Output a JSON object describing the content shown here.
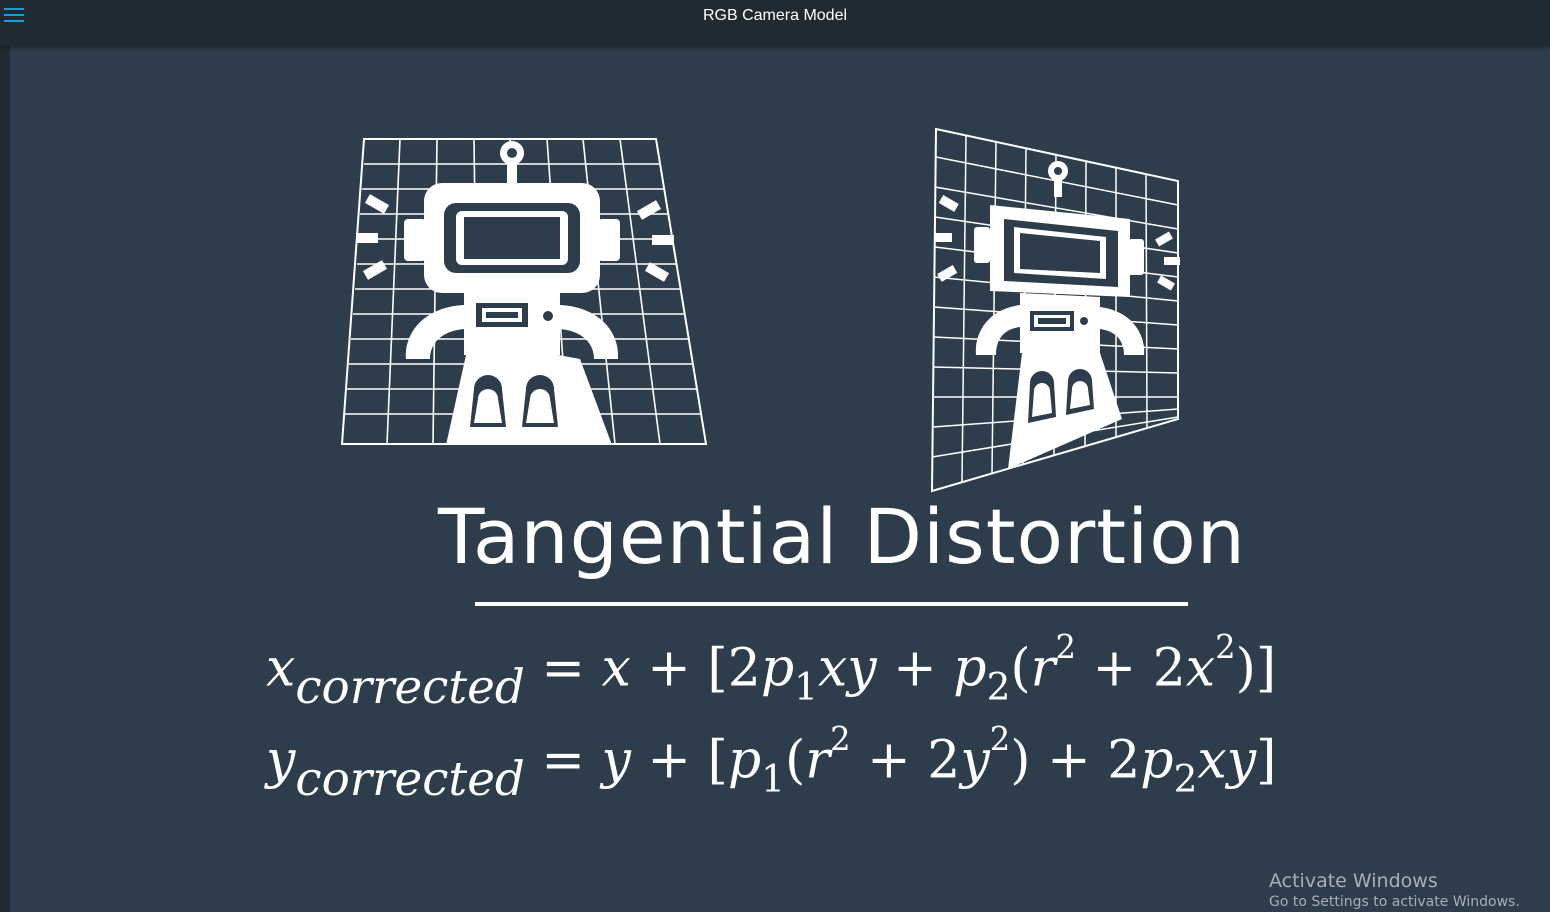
{
  "app": {
    "title": "RGB Camera Model",
    "menu_icon": "hamburger-menu-icon"
  },
  "slide": {
    "title": "Tangential Distortion",
    "equation_1": {
      "lhs_var": "x",
      "lhs_sub": "corrected",
      "eq": " = ",
      "var_x": "x",
      "plus": " + ",
      "open_bracket": "[",
      "coef_2": "2",
      "p": "p",
      "sub_1": "1",
      "xy": "xy",
      "plus_2": " + ",
      "p_2": "p",
      "sub_2": "2",
      "open_paren": "(",
      "r": "r",
      "sup_2": "2",
      "plus_3": " + ",
      "coef_2b": "2",
      "x_2": "x",
      "sup_2b": "2",
      "close": ")]"
    },
    "equation_2": {
      "lhs_var": "y",
      "lhs_sub": "corrected",
      "eq": " = ",
      "var_y": "y",
      "plus": " + ",
      "open_bracket": "[",
      "p": "p",
      "sub_1": "1",
      "open_paren": "(",
      "r": "r",
      "sup_2": "2",
      "plus_2": " + ",
      "coef_2": "2",
      "y_2": "y",
      "sup_2b": "2",
      "close_paren": ")",
      "plus_3": " + ",
      "coef_2b": "2",
      "p_2": "p",
      "sub_2": "2",
      "xy": "xy",
      "close": "]"
    },
    "figures": [
      {
        "name": "robot-on-grid-undistorted",
        "description_icon": "robot-icon"
      },
      {
        "name": "robot-on-grid-tilted",
        "description_icon": "robot-icon"
      }
    ]
  },
  "watermark": {
    "title": "Activate Windows",
    "subtitle": "Go to Settings to activate Windows."
  },
  "colors": {
    "background": "#2e3d4b",
    "topbar": "#1f2a33",
    "accent": "#18a0d8",
    "foreground": "#ffffff"
  }
}
